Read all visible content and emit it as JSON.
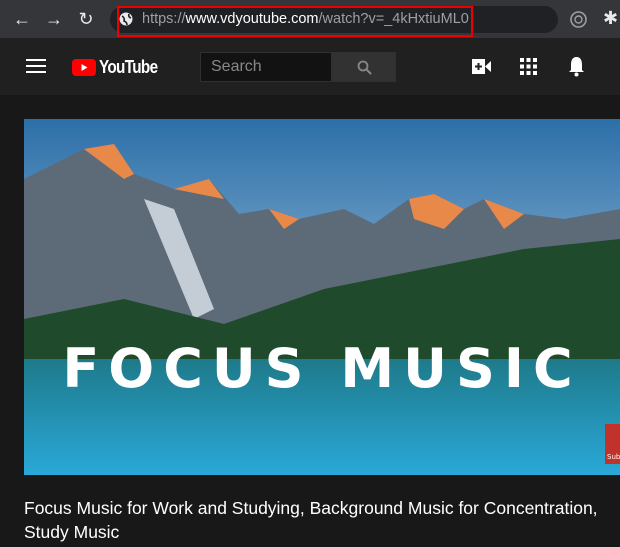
{
  "browser": {
    "url_scheme": "https://",
    "url_host": "www.vdyoutube.com",
    "url_path": "/watch?v=_4kHxtiuML0",
    "highlight_color": "#e00000"
  },
  "header": {
    "logo_text": "YouTube",
    "search_placeholder": "Search",
    "brand_color": "#ff0000"
  },
  "video": {
    "thumbnail_text": "FOCUS MUSIC",
    "subscribe_badge": "Sub",
    "title": "Focus Music for Work and Studying, Background Music for Concentration, Study Music"
  }
}
